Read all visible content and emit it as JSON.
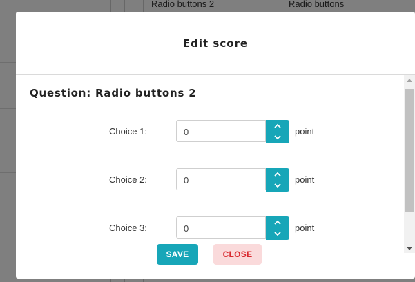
{
  "background": {
    "columns": [
      "Radio buttons 2",
      "Radio buttons"
    ]
  },
  "modal": {
    "title": "Edit score",
    "question_title": "Question: Radio buttons 2",
    "choices": [
      {
        "label": "Choice 1:",
        "value": "0",
        "unit": "point"
      },
      {
        "label": "Choice 2:",
        "value": "0",
        "unit": "point"
      },
      {
        "label": "Choice 3:",
        "value": "0",
        "unit": "point"
      }
    ],
    "buttons": {
      "save": "SAVE",
      "close": "CLOSE"
    }
  },
  "colors": {
    "accent": "#17a6b8",
    "close_bg": "#fadadb",
    "close_text": "#d9292f"
  },
  "icons": {
    "spin_up": "chevron-up-icon",
    "spin_down": "chevron-down-icon",
    "scroll_up": "triangle-up-icon",
    "scroll_down": "triangle-down-icon"
  }
}
